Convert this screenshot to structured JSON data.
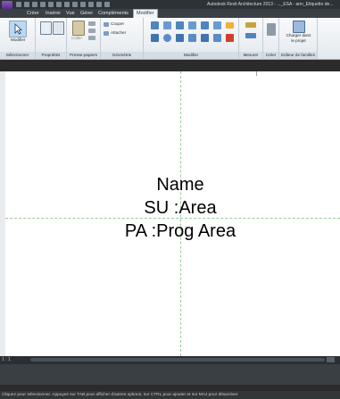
{
  "window": {
    "title": "Autodesk Revit Architecture 2013 -  ..._ESA - ann_Etiquette de..."
  },
  "ribbon_tabs": [
    {
      "label": "Créer",
      "active": false
    },
    {
      "label": "Insérer",
      "active": false
    },
    {
      "label": "Vue",
      "active": false
    },
    {
      "label": "Gérer",
      "active": false
    },
    {
      "label": "Compléments",
      "active": false
    },
    {
      "label": "Modifier",
      "active": true
    }
  ],
  "ribbon": {
    "select": {
      "modify_label": "Modifier",
      "panel": "Sélectionner"
    },
    "properties": {
      "panel": "Propriétés"
    },
    "clipboard": {
      "paste_label": "Coller",
      "panel": "Presse-papiers"
    },
    "geometry": {
      "cut_label": "Couper",
      "join_label": "Attacher",
      "panel": "Géométrie"
    },
    "modify": {
      "panel": "Modifier"
    },
    "measure": {
      "panel": "Mesurer"
    },
    "create": {
      "panel": "Créer"
    },
    "family_editor": {
      "load_label": "Charger dans\nle projet",
      "panel": "Editeur de familles"
    }
  },
  "tag_text": {
    "line1": "Name",
    "line2": "SU :Area",
    "line3": "PA :Prog Area"
  },
  "view_bar": {
    "scale": "1 : 1"
  },
  "status_bar": {
    "text": "Cliquez pour sélectionner. Appuyez sur TAB pour afficher d'autres options, sur CTRL pour ajouter et sur MAJ pour désactiver."
  },
  "colors": {
    "guide": "#9fc79f",
    "ribbon_bg": "#e8ecf0",
    "title_bg": "#2d3236",
    "logo": "#6b3fa0"
  }
}
